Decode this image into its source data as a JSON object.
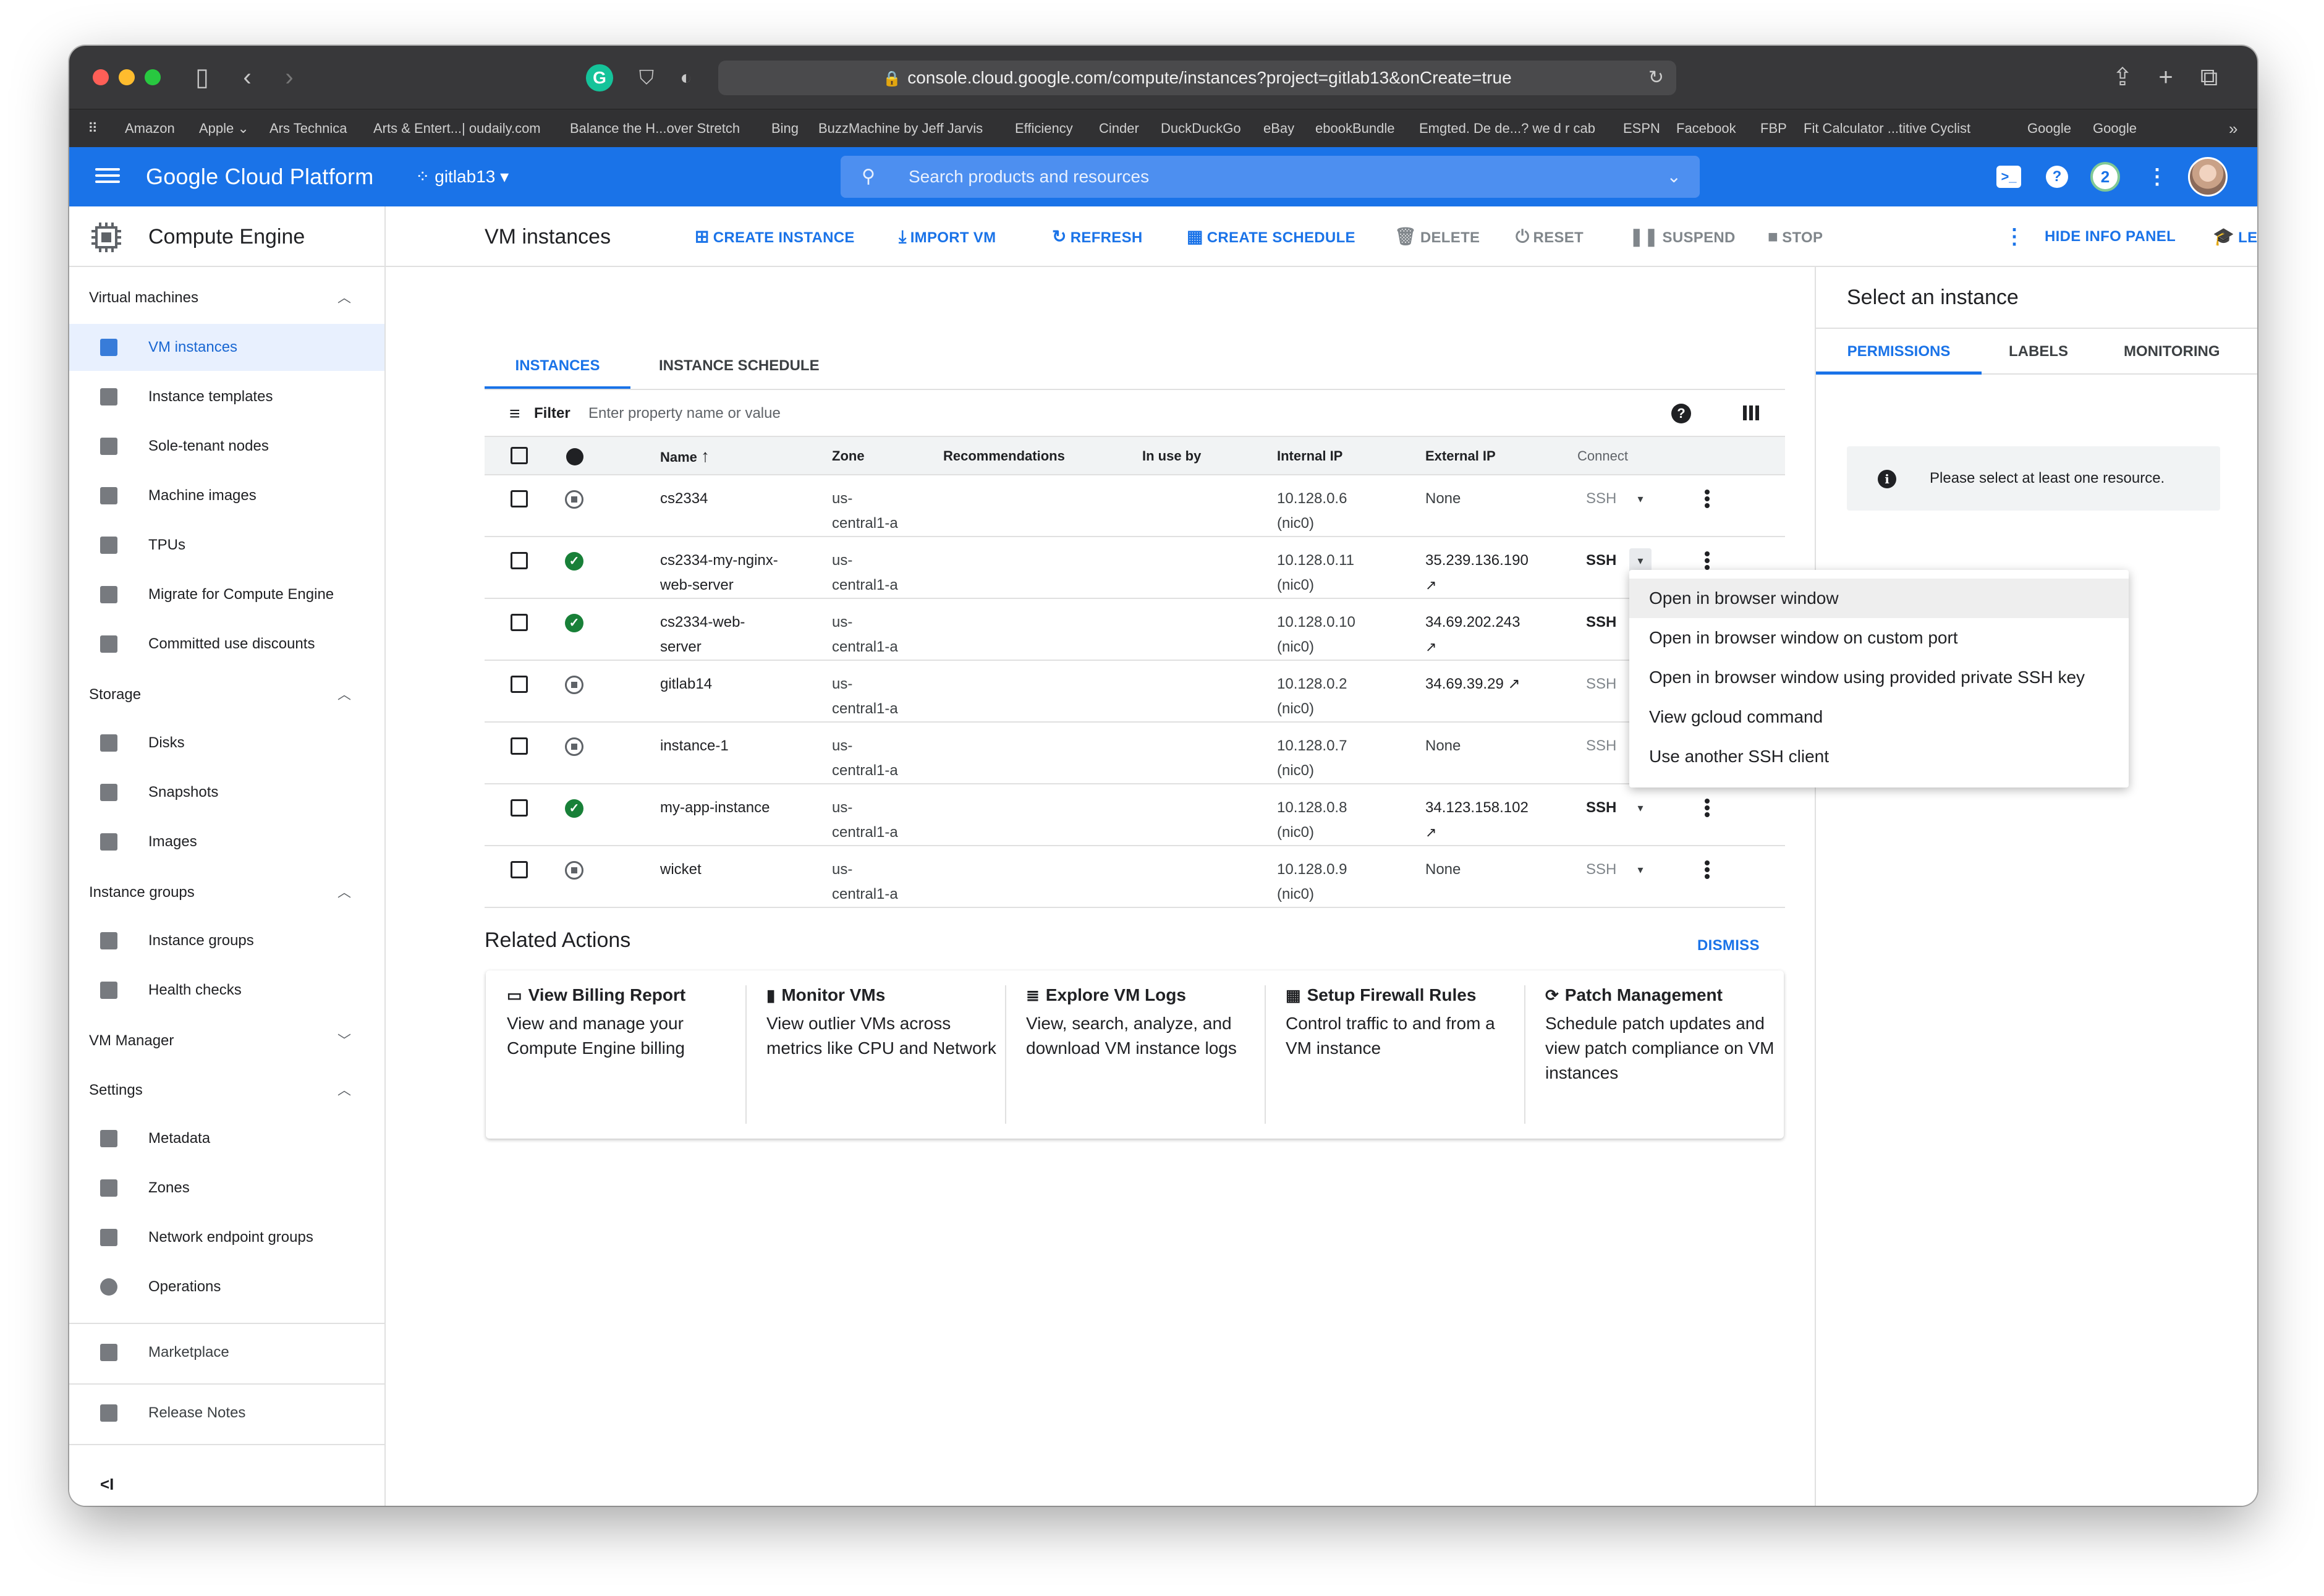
{
  "browser": {
    "url": "console.cloud.google.com/compute/instances?project=gitlab13&onCreate=true",
    "bookmarks": [
      "Amazon",
      "Apple ⌄",
      "Ars Technica",
      "Arts & Entert...| oudaily.com",
      "Balance the H...over Stretch",
      "Bing",
      "BuzzMachine by Jeff Jarvis",
      "Efficiency",
      "Cinder",
      "DuckDuckGo",
      "eBay",
      "ebookBundle",
      "Emgted. De de...? we d r cab",
      "ESPN",
      "Facebook",
      "FBP",
      "Fit Calculator ...titive Cyclist",
      "Google",
      "Google"
    ]
  },
  "header": {
    "brand": "Google Cloud Platform",
    "project": "gitlab13",
    "search_placeholder": "Search products and resources",
    "notification_count": "2"
  },
  "leftnav": {
    "title": "Compute Engine",
    "sections": [
      {
        "label": "Virtual machines",
        "items": [
          "VM instances",
          "Instance templates",
          "Sole-tenant nodes",
          "Machine images",
          "TPUs",
          "Migrate for Compute Engine",
          "Committed use discounts"
        ]
      },
      {
        "label": "Storage",
        "items": [
          "Disks",
          "Snapshots",
          "Images"
        ]
      },
      {
        "label": "Instance groups",
        "items": [
          "Instance groups",
          "Health checks"
        ]
      },
      {
        "label": "VM Manager",
        "items": []
      },
      {
        "label": "Settings",
        "items": [
          "Metadata",
          "Zones",
          "Network endpoint groups",
          "Operations"
        ]
      }
    ],
    "footer": [
      "Marketplace",
      "Release Notes"
    ],
    "collapse": "<I"
  },
  "toolbar": {
    "title": "VM instances",
    "create_instance": "CREATE INSTANCE",
    "import_vm": "IMPORT VM",
    "refresh": "REFRESH",
    "create_schedule": "CREATE SCHEDULE",
    "delete": "DELETE",
    "reset": "RESET",
    "suspend": "SUSPEND",
    "stop": "STOP",
    "hide_info_panel": "HIDE INFO PANEL",
    "learn": "LEARN"
  },
  "tabs": {
    "instances": "INSTANCES",
    "instance_schedule": "INSTANCE SCHEDULE"
  },
  "filter": {
    "label": "Filter",
    "placeholder": "Enter property name or value"
  },
  "table": {
    "headers": {
      "name": "Name",
      "zone": "Zone",
      "recommendations": "Recommendations",
      "in_use_by": "In use by",
      "internal_ip": "Internal IP",
      "external_ip": "External IP",
      "connect": "Connect"
    },
    "rows": [
      {
        "name1": "cs2334",
        "name2": "",
        "running": false,
        "zone1": "us-",
        "zone2": "central1-a",
        "ip1": "10.128.0.6",
        "ip2": "(nic0)",
        "ext1": "None",
        "ext2": "",
        "ssh": "SSH"
      },
      {
        "name1": "cs2334-my-nginx-",
        "name2": "web-server",
        "running": true,
        "zone1": "us-",
        "zone2": "central1-a",
        "ip1": "10.128.0.11",
        "ip2": "(nic0)",
        "ext1": "35.239.136.190",
        "ext2": "↗",
        "ssh": "SSH"
      },
      {
        "name1": "cs2334-web-",
        "name2": "server",
        "running": true,
        "zone1": "us-",
        "zone2": "central1-a",
        "ip1": "10.128.0.10",
        "ip2": "(nic0)",
        "ext1": "34.69.202.243",
        "ext2": "↗",
        "ssh": "SSH"
      },
      {
        "name1": "gitlab14",
        "name2": "",
        "running": false,
        "zone1": "us-",
        "zone2": "central1-a",
        "ip1": "10.128.0.2",
        "ip2": "(nic0)",
        "ext1": "34.69.39.29 ↗",
        "ext2": "",
        "ssh": "SSH"
      },
      {
        "name1": "instance-1",
        "name2": "",
        "running": false,
        "zone1": "us-",
        "zone2": "central1-a",
        "ip1": "10.128.0.7",
        "ip2": "(nic0)",
        "ext1": "None",
        "ext2": "",
        "ssh": "SSH"
      },
      {
        "name1": "my-app-instance",
        "name2": "",
        "running": true,
        "zone1": "us-",
        "zone2": "central1-a",
        "ip1": "10.128.0.8",
        "ip2": "(nic0)",
        "ext1": "34.123.158.102",
        "ext2": "↗",
        "ssh": "SSH"
      },
      {
        "name1": "wicket",
        "name2": "",
        "running": false,
        "zone1": "us-",
        "zone2": "central1-a",
        "ip1": "10.128.0.9",
        "ip2": "(nic0)",
        "ext1": "None",
        "ext2": "",
        "ssh": "SSH"
      }
    ]
  },
  "ssh_menu": {
    "items": [
      "Open in browser window",
      "Open in browser window on custom port",
      "Open in browser window using provided private SSH key",
      "View gcloud command",
      "Use another SSH client"
    ]
  },
  "related": {
    "title": "Related Actions",
    "dismiss": "DISMISS",
    "cards": [
      {
        "title": "View Billing Report",
        "desc": "View and manage your Compute Engine billing"
      },
      {
        "title": "Monitor VMs",
        "desc": "View outlier VMs across metrics like CPU and Network"
      },
      {
        "title": "Explore VM Logs",
        "desc": "View, search, analyze, and download VM instance logs"
      },
      {
        "title": "Setup Firewall Rules",
        "desc": "Control traffic to and from a VM instance"
      },
      {
        "title": "Patch Management",
        "desc": "Schedule patch updates and view patch compliance on VM instances"
      }
    ]
  },
  "infopanel": {
    "title": "Select an instance",
    "tabs": [
      "PERMISSIONS",
      "LABELS",
      "MONITORING"
    ],
    "message": "Please select at least one resource."
  },
  "colors": {
    "brand_blue": "#1a73e8",
    "running_green": "#188038",
    "chrome_dark": "#38383a"
  }
}
